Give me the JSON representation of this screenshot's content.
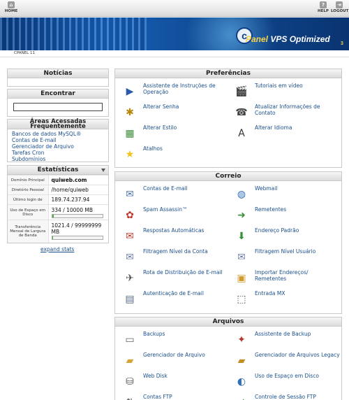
{
  "topbar": {
    "home": "HOME",
    "help": "HELP",
    "logout": "LOGOUT"
  },
  "brand": {
    "c": "c",
    "name": "Panel",
    "suffix": " VPS Optimized",
    "version": "3"
  },
  "breadcrumb": "CPANEL 11",
  "sidebar": {
    "news_title": "Notícias",
    "find_title": "Encontrar",
    "search_value": "",
    "frequent_title": "Áreas Acessadas Frequentemente",
    "frequent_links": [
      "Bancos de dados MySQL®",
      "Contas de E-mail",
      "Gerenciador de Arquivo",
      "Tarefas Cron",
      "Subdomínios"
    ],
    "stats_title": "Estatísticas",
    "stats": [
      {
        "label": "Domínio Principal",
        "value": "quiweb.com"
      },
      {
        "label": "Diretório Pessoal",
        "value": "/home/quiweb"
      },
      {
        "label": "Último login de",
        "value": "189.74.237.94"
      },
      {
        "label": "Uso de Espaço em Disco",
        "value": "334 / 10000 MB",
        "usage": 0.0334
      },
      {
        "label": "Transferência Mensal de Largura de Banda",
        "value": "1021.4 / 99999999 MB",
        "usage": 1e-05
      }
    ],
    "expand": "expand stats"
  },
  "preferencias": {
    "title": "Preferências",
    "items": [
      {
        "label": "Assistente de Instruções de Operação",
        "icon": "play-icon"
      },
      {
        "label": "Tutoriais em vídeo",
        "icon": "video-icon"
      },
      {
        "label": "Alterar Senha",
        "icon": "password-icon"
      },
      {
        "label": "Atualizar Informações de Contato",
        "icon": "contact-icon"
      },
      {
        "label": "Alterar Estilo",
        "icon": "style-icon"
      },
      {
        "label": "Alterar Idioma",
        "icon": "language-icon"
      },
      {
        "label": "Atalhos",
        "icon": "star-icon"
      }
    ]
  },
  "correio": {
    "title": "Correio",
    "items": [
      {
        "label": "Contas de E-mail",
        "icon": "email-icon"
      },
      {
        "label": "Webmail",
        "icon": "webmail-icon"
      },
      {
        "label": "Spam Assassin™",
        "icon": "spam-icon"
      },
      {
        "label": "Remetentes",
        "icon": "forwarders-icon"
      },
      {
        "label": "Respostas Automáticas",
        "icon": "autoresponder-icon"
      },
      {
        "label": "Endereço Padrão",
        "icon": "default-address-icon"
      },
      {
        "label": "Filtragem Nível da Conta",
        "icon": "filter-icon"
      },
      {
        "label": "Filtragem Nível Usuário",
        "icon": "user-filter-icon"
      },
      {
        "label": "Rota de Distribuição de E-mail",
        "icon": "routing-icon"
      },
      {
        "label": "Importar Endereços/ Remetentes",
        "icon": "import-icon"
      },
      {
        "label": "Autenticação de E-mail",
        "icon": "auth-icon"
      },
      {
        "label": "Entrada MX",
        "icon": "mx-icon"
      }
    ]
  },
  "arquivos": {
    "title": "Arquivos",
    "items": [
      {
        "label": "Backups",
        "icon": "backup-icon"
      },
      {
        "label": "Assistente de Backup",
        "icon": "backup-wizard-icon"
      },
      {
        "label": "Gerenciador de Arquivo",
        "icon": "folder-icon"
      },
      {
        "label": "Gerenciador de Arquivos Legacy",
        "icon": "legacy-folder-icon"
      },
      {
        "label": "Web Disk",
        "icon": "webdisk-icon"
      },
      {
        "label": "Uso de Espaço em Disco",
        "icon": "disk-usage-icon"
      },
      {
        "label": "Contas FTP",
        "icon": "ftp-icon"
      },
      {
        "label": "Controle de Sessão FTP",
        "icon": "ftp-session-icon"
      }
    ]
  }
}
